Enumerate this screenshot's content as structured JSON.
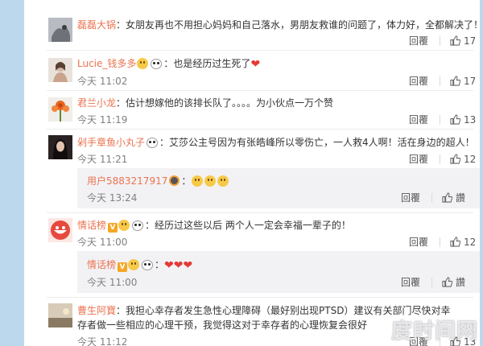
{
  "comments": [
    {
      "user": "磊磊大锅",
      "text": "女朋友再也不用担心妈妈和自己落水，男朋友救谁的问题了，体力好，全都解决了！",
      "reply": "回覆",
      "likes": "17"
    },
    {
      "user": "Lucie_钱多多",
      "text": "也是经历过生死了",
      "time": "今天 11:02",
      "reply": "回覆",
      "likes": "17"
    },
    {
      "user": "君兰小龙",
      "text": "估计想嫁他的该排长队了。。。。为小伙点一万个赞",
      "time": "今天 11:19",
      "reply": "回覆",
      "likes": "13"
    },
    {
      "user": "剁手章鱼小丸子",
      "text": "艾莎公主号因为有张皓峰所以零伤亡，一人救4人啊！活在身边的超人！",
      "time": "今天 11:21",
      "reply": "回覆",
      "likes": "12",
      "sub": {
        "user": "用户5883217917",
        "time": "今天 13:24",
        "reply": "回覆",
        "likes": "讚"
      }
    },
    {
      "user": "情话榜",
      "text": "经历过这些以后 两个人一定会幸福一辈子的！",
      "time": "今天 11:00",
      "reply": "回覆",
      "likes": "12",
      "sub": {
        "user": "情话榜",
        "time": "今天 11:00",
        "reply": "回覆",
        "likes": "讚"
      }
    },
    {
      "user": "曹生阿寶",
      "text": "我担心幸存者发生急性心理障碍（最好别出现PTSD）建议有关部门尽快对幸",
      "text2": "存者做一些相应的心理干预，我觉得这对于幸存者的心理恢复会很好",
      "time": "今天 11:12",
      "reply": "回覆",
      "likes": "13"
    }
  ],
  "watermark": "度时间网"
}
